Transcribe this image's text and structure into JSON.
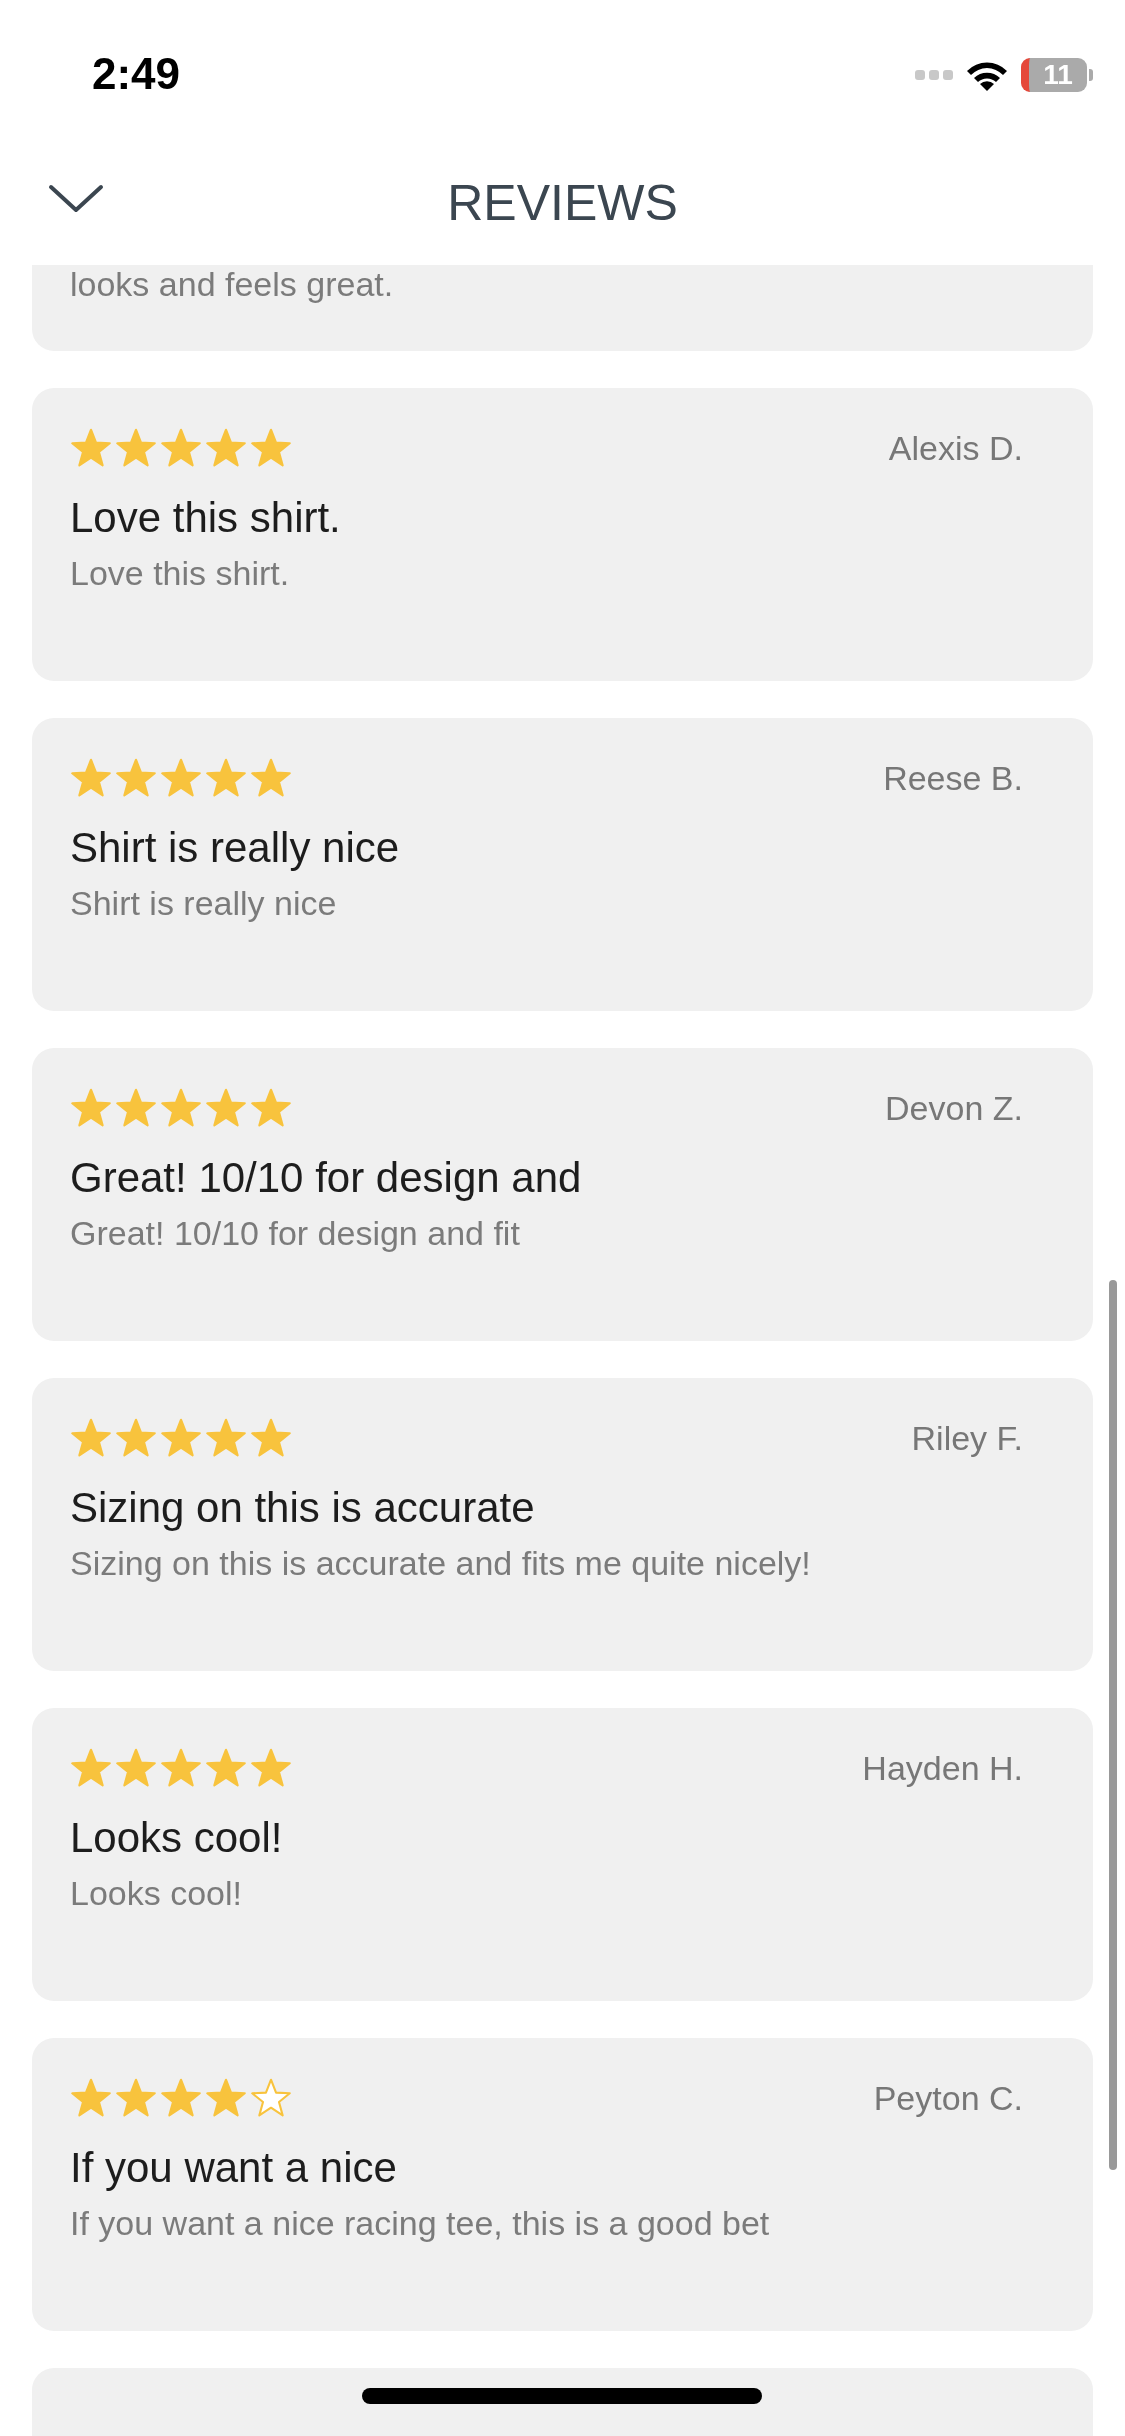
{
  "status_bar": {
    "time": "2:49",
    "battery": "11"
  },
  "header": {
    "title": "REVIEWS"
  },
  "partial_review": {
    "body": "looks and feels great."
  },
  "reviews": [
    {
      "stars": 5,
      "author": "Alexis D.",
      "title": "Love this shirt.",
      "body": "Love this shirt."
    },
    {
      "stars": 5,
      "author": "Reese B.",
      "title": "Shirt is really nice",
      "body": "Shirt is really nice"
    },
    {
      "stars": 5,
      "author": "Devon Z.",
      "title": "Great! 10/10 for design and",
      "body": "Great! 10/10 for design and fit"
    },
    {
      "stars": 5,
      "author": "Riley F.",
      "title": "Sizing on this is accurate",
      "body": "Sizing on this is accurate and fits me quite nicely!"
    },
    {
      "stars": 5,
      "author": "Hayden H.",
      "title": "Looks cool!",
      "body": "Looks cool!"
    },
    {
      "stars": 4,
      "author": "Peyton C.",
      "title": "If you want a nice",
      "body": "If you want a nice racing tee, this is a good bet"
    }
  ]
}
